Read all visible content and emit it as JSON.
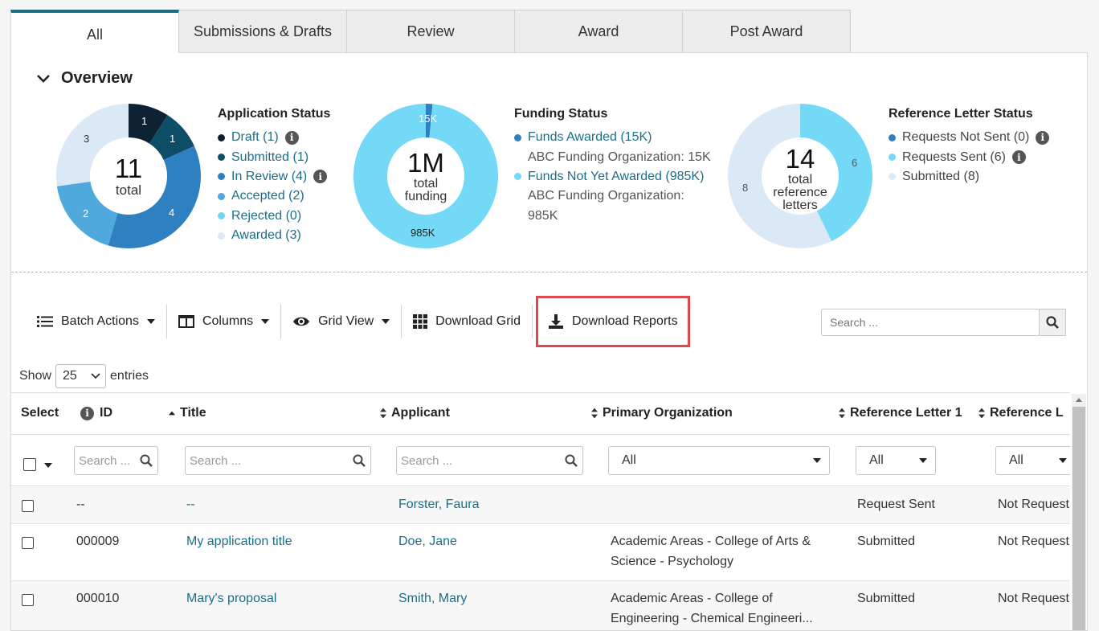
{
  "tabs": [
    {
      "label": "All"
    },
    {
      "label": "Submissions & Drafts"
    },
    {
      "label": "Review"
    },
    {
      "label": "Award"
    },
    {
      "label": "Post Award"
    }
  ],
  "overview": {
    "title": "Overview",
    "application_status": {
      "title": "Application Status",
      "center_value": "11",
      "center_label": "total",
      "items": [
        {
          "label": "Draft (1)",
          "color": "#0d2233",
          "value": 1,
          "info": true
        },
        {
          "label": "Submitted (1)",
          "color": "#0e4d66",
          "value": 1
        },
        {
          "label": "In Review (4)",
          "color": "#2f80c0",
          "value": 4,
          "info": true
        },
        {
          "label": "Accepted (2)",
          "color": "#4fa9dc",
          "value": 2
        },
        {
          "label": "Rejected (0)",
          "color": "#6dd6f5",
          "value": 0
        },
        {
          "label": "Awarded (3)",
          "color": "#dbe9f6",
          "value": 3
        }
      ],
      "segment_labels": [
        "1",
        "1",
        "4",
        "2",
        "3"
      ]
    },
    "funding_status": {
      "title": "Funding Status",
      "center_value": "1M",
      "center_label_1": "total",
      "center_label_2": "funding",
      "awarded_label": "Funds Awarded (15K)",
      "awarded_color": "#2f80c0",
      "awarded_sub": "ABC Funding Organization: 15K",
      "not_awarded_label": "Funds Not Yet Awarded (985K)",
      "not_awarded_color": "#73d9f7",
      "not_awarded_sub_1": "ABC Funding Organization:",
      "not_awarded_sub_2": "985K",
      "values": [
        15,
        985
      ],
      "segment_labels": [
        "15K",
        "985K"
      ]
    },
    "reference_status": {
      "title": "Reference Letter Status",
      "center_value": "14",
      "center_label_1": "total",
      "center_label_2": "reference",
      "center_label_3": "letters",
      "items": [
        {
          "label": "Requests Not Sent (0)",
          "color": "#2f80c0",
          "value": 0,
          "info": true
        },
        {
          "label": "Requests Sent (6)",
          "color": "#73d9f7",
          "value": 6,
          "info": true
        },
        {
          "label": "Submitted (8)",
          "color": "#dbe9f6",
          "value": 8
        }
      ],
      "segment_labels": [
        "6",
        "8"
      ]
    }
  },
  "toolbar": {
    "batch_actions": "Batch Actions",
    "columns": "Columns",
    "grid_view": "Grid View",
    "download_grid": "Download Grid",
    "download_reports": "Download Reports",
    "search_placeholder": "Search ..."
  },
  "show_entries": {
    "show": "Show",
    "value": "25",
    "entries": "entries"
  },
  "table": {
    "headers": {
      "select": "Select",
      "id": "ID",
      "title": "Title",
      "applicant": "Applicant",
      "organization": "Primary Organization",
      "ref1": "Reference Letter 1",
      "ref2": "Reference L"
    },
    "filters": {
      "id_placeholder": "Search ...",
      "title_placeholder": "Search ...",
      "applicant_placeholder": "Search ...",
      "org_value": "All",
      "ref1_value": "All",
      "ref2_value": "All"
    },
    "rows": [
      {
        "id": "--",
        "title": "--",
        "applicant": "Forster, Faura",
        "org_1": "",
        "org_2": "",
        "ref1": "Request Sent",
        "ref2": "Not Request"
      },
      {
        "id": "000009",
        "title": "My application title",
        "applicant": "Doe, Jane",
        "org_1": "Academic Areas - College of Arts &",
        "org_2": "Science - Psychology",
        "ref1": "Submitted",
        "ref2": "Not Request"
      },
      {
        "id": "000010",
        "title": "Mary's proposal",
        "applicant": "Smith, Mary",
        "org_1": "Academic Areas - College of",
        "org_2": "Engineering - Chemical Engineeri...",
        "ref1": "Submitted",
        "ref2": "Not Request"
      }
    ]
  }
}
